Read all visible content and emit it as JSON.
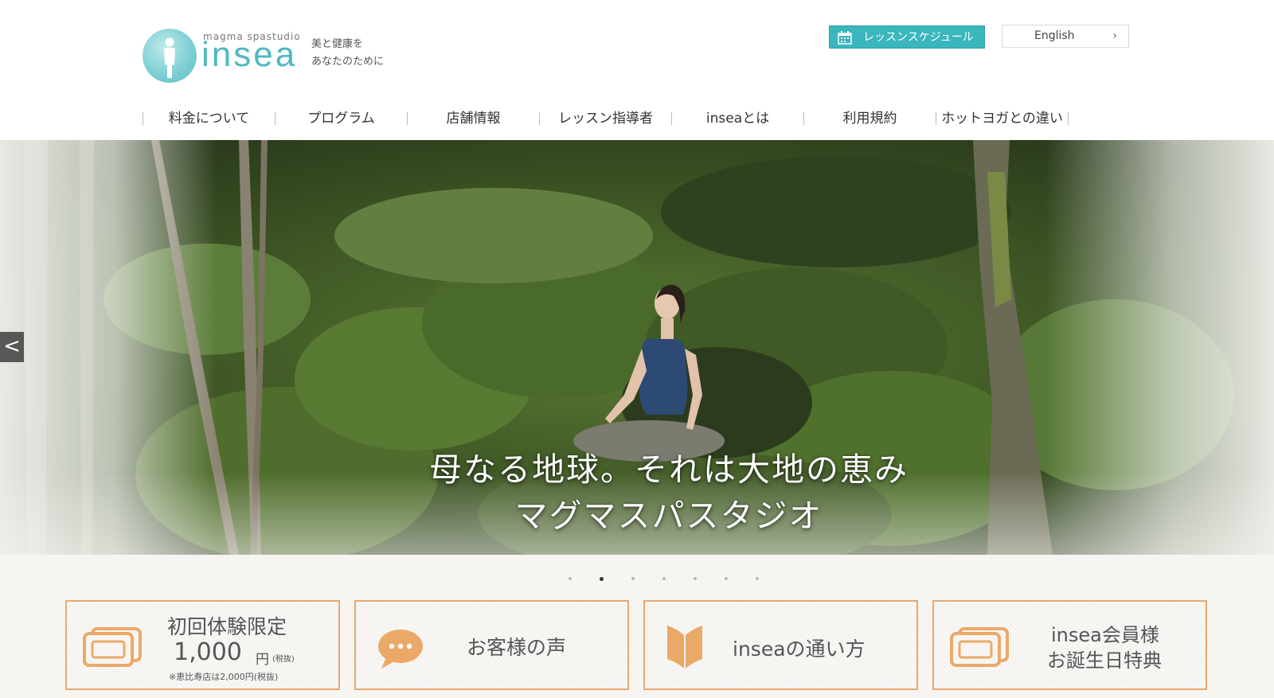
{
  "header": {
    "logo_small": "magma spastudio",
    "logo_word": "insea",
    "tagline_1": "美と健康を",
    "tagline_2": "あなたのために",
    "schedule_button": "レッスンスケジュール",
    "language_button": "English",
    "language_chevron": "›"
  },
  "nav": [
    {
      "label": "料金について"
    },
    {
      "label": "プログラム"
    },
    {
      "label": "店舗情報"
    },
    {
      "label": "レッスン指導者"
    },
    {
      "label": "inseaとは"
    },
    {
      "label": "利用規約"
    },
    {
      "label": "ホットヨガとの違い"
    }
  ],
  "hero": {
    "caption_line1": "母なる地球。それは大地の恵み",
    "caption_line2": "マグマスパスタジオ",
    "prev_arrow": "<",
    "slide_count": 7,
    "active_slide": 2
  },
  "cards": [
    {
      "title": "初回体験限定",
      "price": "1,000",
      "unit": "円",
      "tax": "(税抜)",
      "note": "※恵比寿店は2,000円(税抜)",
      "icon": "ticket-icon"
    },
    {
      "title": "お客様の声",
      "icon": "speech-bubble-icon"
    },
    {
      "title": "inseaの通い方",
      "icon": "book-icon"
    },
    {
      "title_1": "insea会員様",
      "title_2": "お誕生日特典",
      "icon": "ticket-icon"
    }
  ],
  "colors": {
    "accent_teal": "#3ab6bd",
    "card_border": "#e8a870",
    "icon_orange": "#eba968"
  }
}
